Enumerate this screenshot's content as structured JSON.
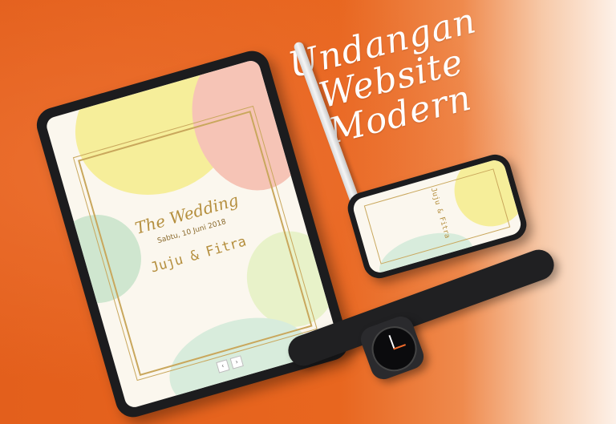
{
  "headline": {
    "line1": "Undangan",
    "line2": "Website",
    "line3": "Modern"
  },
  "card": {
    "title": "The Wedding",
    "date": "Sabtu, 10 Juni 2018",
    "names": "Juju & Fitra"
  },
  "colors": {
    "background": "#e8631f",
    "accent_gold": "#c9a75c",
    "blob_yellow": "#f6ee9a",
    "blob_pink": "#f6c4b6",
    "blob_green": "#d8ecdc"
  },
  "pager": [
    "‹",
    "›"
  ]
}
